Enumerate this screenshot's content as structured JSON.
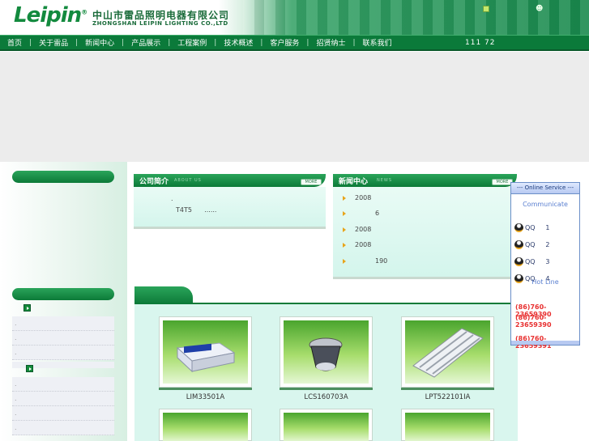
{
  "header": {
    "logo": "Leipin",
    "logo_mark": "®",
    "company_cn": "中山市雷品照明电器有限公司",
    "company_en": "ZHONGSHAN LEIPIN LIGHTING CO.,LTD"
  },
  "nav": {
    "items": [
      "首页",
      "关于雷品",
      "新闻中心",
      "产品展示",
      "工程案例",
      "技术概述",
      "客户服务",
      "招贤纳士",
      "联系我们"
    ],
    "separator": "|",
    "counter": "111 72"
  },
  "about": {
    "title": "公司简介",
    "title_en": "ABOUT US",
    "more": "MORE",
    "line1": ".",
    "line2": "T4T5",
    "line2_suffix": "......"
  },
  "news": {
    "title": "新闻中心",
    "title_en": "NEWS",
    "more": "MORE",
    "items": [
      "2008",
      "6",
      "2008",
      "2008",
      "190"
    ]
  },
  "products": {
    "items": [
      {
        "name": "LIM33501A",
        "icon": "ballast-box"
      },
      {
        "name": "LCS160703A",
        "icon": "downlight"
      },
      {
        "name": "LPT522101IA",
        "icon": "grille-lamp"
      }
    ]
  },
  "online": {
    "header": "--- Online Service ---",
    "sub": "Communicate",
    "qq_label": "QQ",
    "qq": [
      "1",
      "2",
      "3",
      "4"
    ],
    "mid": "Hot Line",
    "phones": [
      "(86)760-23659390",
      "(86)760-23659390",
      "(86)760-23659391"
    ]
  }
}
